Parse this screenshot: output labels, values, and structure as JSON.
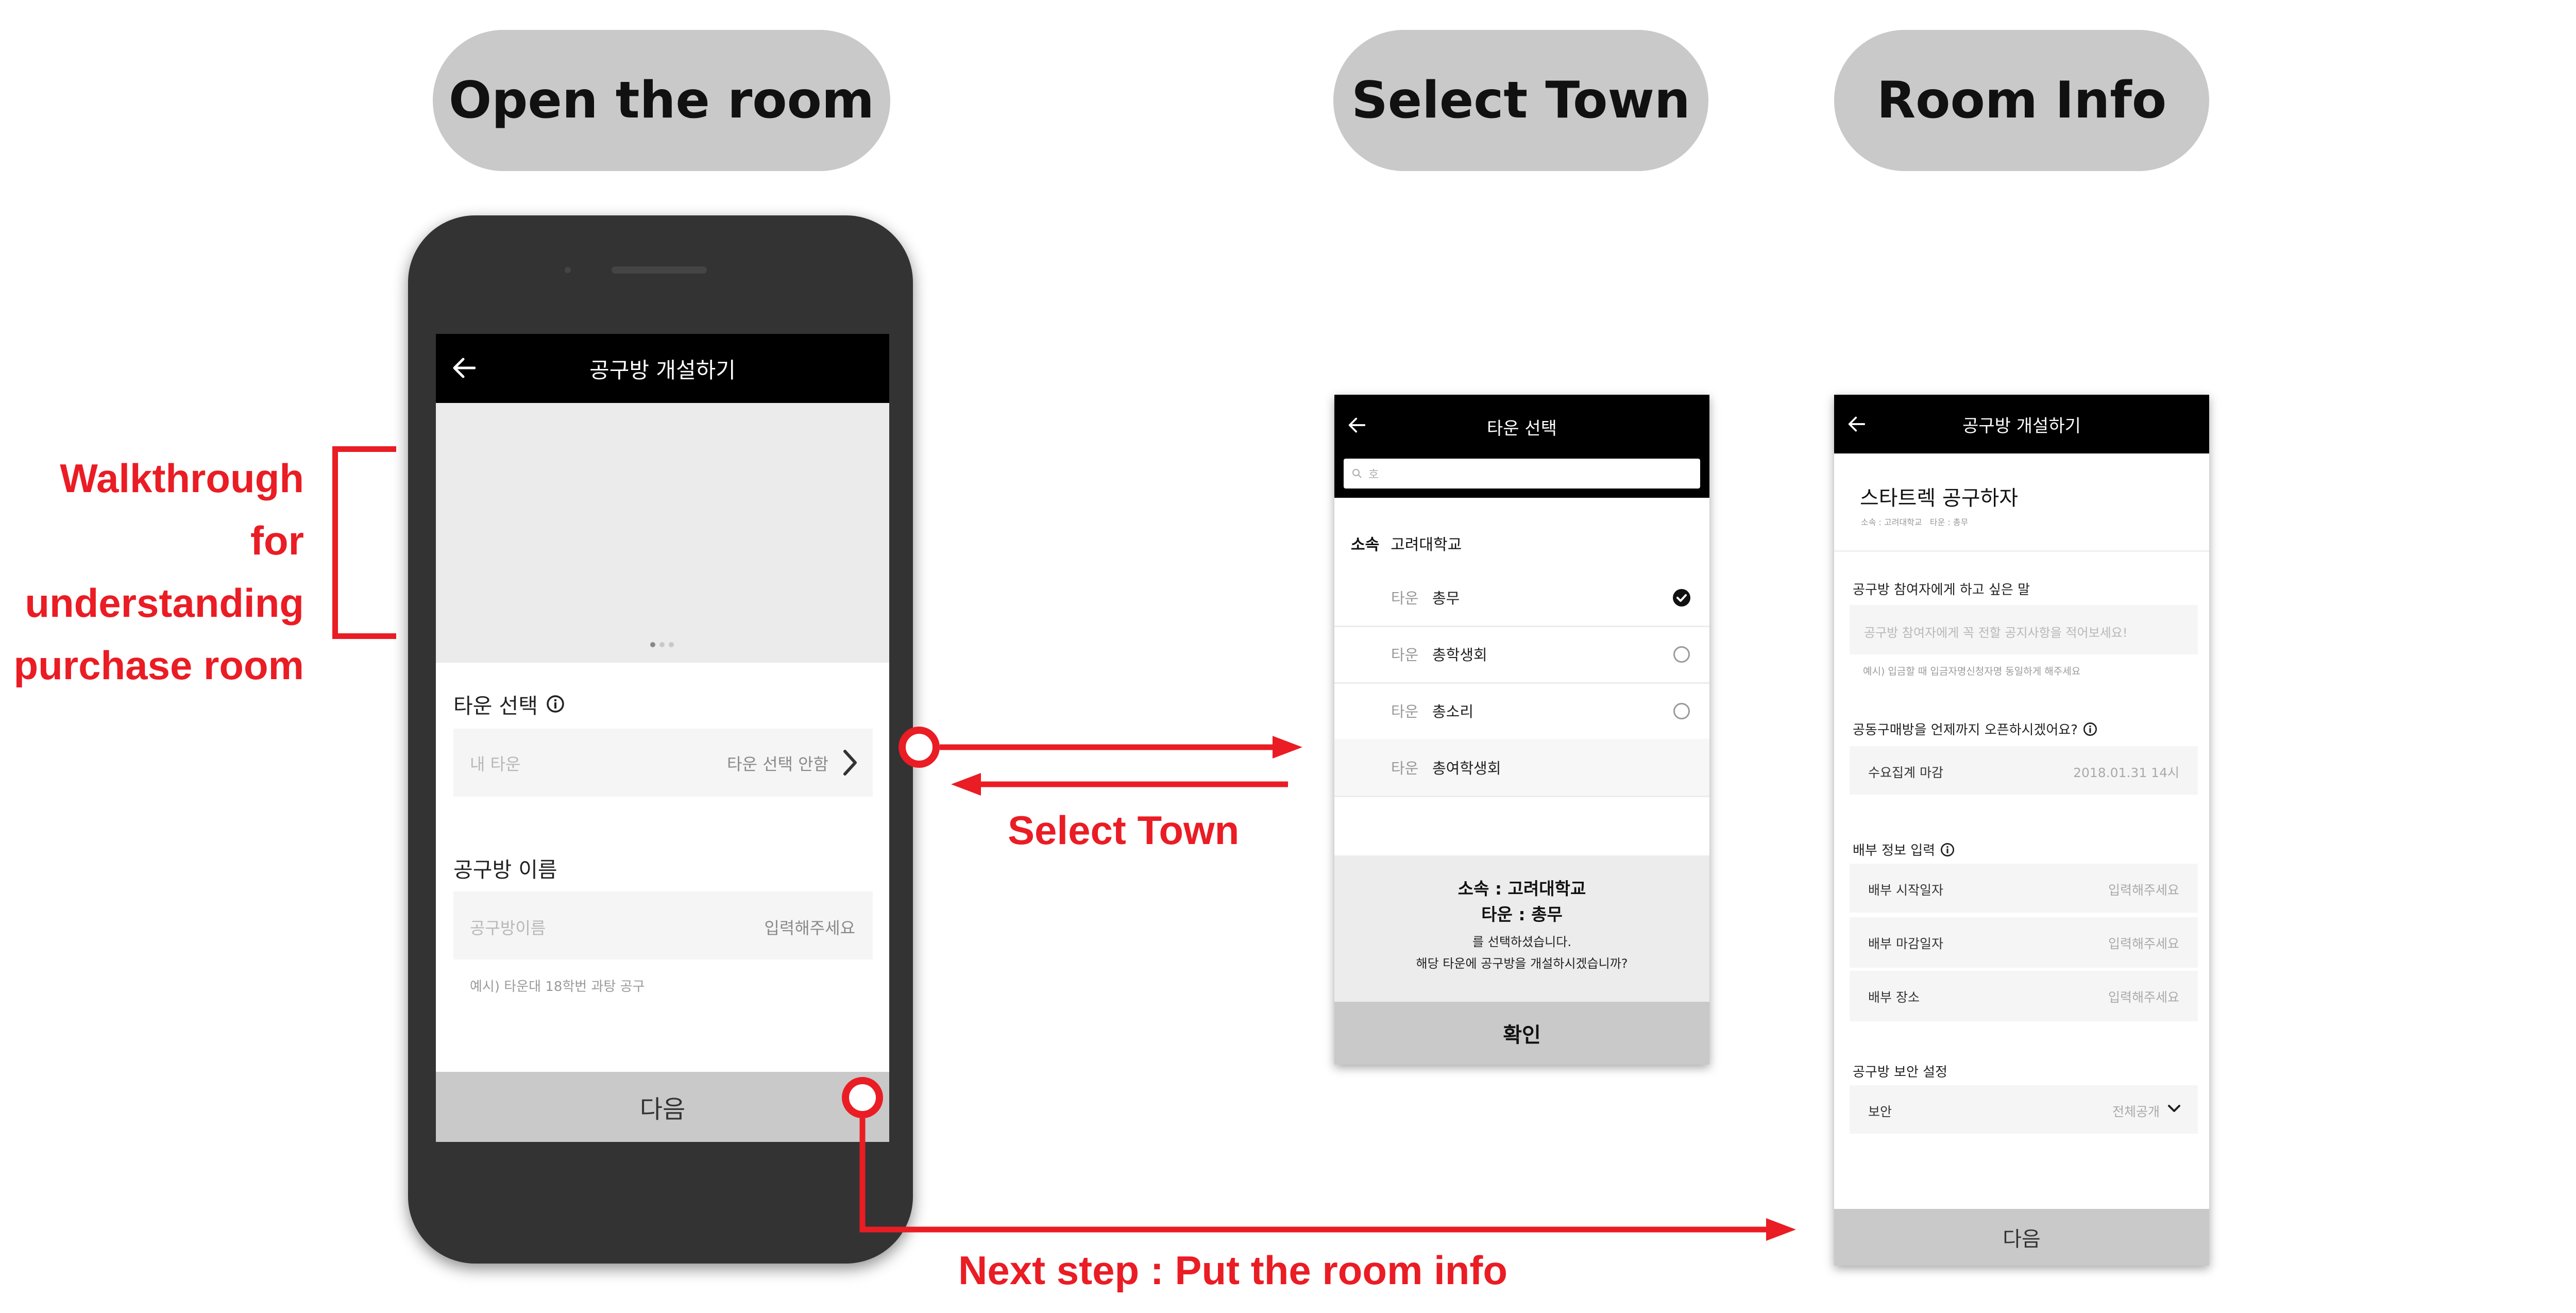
{
  "headers": {
    "open_room": "Open the room",
    "select_town": "Select Town",
    "room_info": "Room Info"
  },
  "annotations": {
    "walkthrough": [
      "Walkthrough for",
      "understanding",
      "purchase room"
    ],
    "select_town": "Select Town",
    "next_step": "Next step : Put the room info"
  },
  "colors": {
    "annotation_red": "#ea1c24",
    "header_pill": "#c9c9c9",
    "appbar": "#000000",
    "bottom_button": "#c9c9c9"
  },
  "icons": {
    "back": "arrow-left-icon",
    "info": "info-circle-icon",
    "next": "chevron-right-icon",
    "search": "search-icon",
    "checked": "check-circle-icon",
    "dropdown": "chevron-down-icon"
  },
  "screen1": {
    "title": "공구방 개설하기",
    "carousel_pages": 3,
    "carousel_active": 1,
    "town_label": "타운 선택",
    "town_field_left": "내 타운",
    "town_field_right": "타운 선택 안함",
    "name_label": "공구방 이름",
    "name_field_left": "공구방이름",
    "name_field_right": "입력해주세요",
    "name_hint": "예시) 타운대 18학번 과탕 공구",
    "next_button": "다음"
  },
  "screen2": {
    "title": "타운 선택",
    "search_placeholder": "호",
    "group_prefix": "소속",
    "group_name": "고려대학교",
    "town_prefix": "타운",
    "towns": [
      {
        "name": "총무",
        "selected": true
      },
      {
        "name": "총학생회",
        "selected": false
      },
      {
        "name": "총소리",
        "selected": false
      },
      {
        "name": "총여학생회",
        "selected": false
      }
    ],
    "confirm_line1": "소속 : 고려대학교",
    "confirm_line2": "타운 : 총무",
    "confirm_line3": "를 선택하셨습니다.",
    "confirm_line4": "해당 타운에 공구방을 개설하시겠습니까?",
    "confirm_button": "확인"
  },
  "screen3": {
    "title": "공구방 개설하기",
    "room_name": "스타트렉 공구하자",
    "room_meta": "소속 : 고려대학교   타운 : 총무",
    "message_label": "공구방 참여자에게 하고 싶은 말",
    "message_placeholder": "공구방 참여자에게 꼭 전할 공지사항을 적어보세요!",
    "message_hint": "예시) 입금할 때 입금자명신청자명 동일하게 해주세요",
    "deadline_label": "공동구매방을 언제까지 오픈하시겠어요?",
    "deadline_field_left": "수요집계 마감",
    "deadline_field_right": "2018.01.31 14시",
    "delivery_label": "배부 정보 입력",
    "delivery_fields": [
      {
        "left": "배부 시작일자",
        "right": "입력해주세요"
      },
      {
        "left": "배부 마감일자",
        "right": "입력해주세요"
      },
      {
        "left": "배부 장소",
        "right": "입력해주세요"
      }
    ],
    "security_label": "공구방 보안 설정",
    "security_field_left": "보안",
    "security_field_right": "전체공개",
    "next_button": "다음"
  }
}
